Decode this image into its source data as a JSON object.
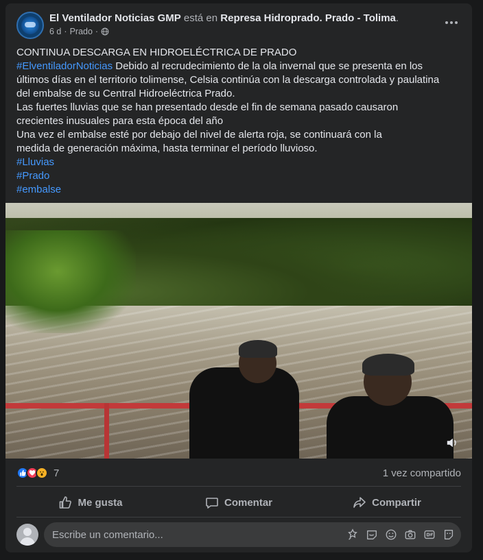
{
  "post": {
    "page_name": "El Ventilador Noticias GMP",
    "location_connector": "está en",
    "location": "Represa Hidroprado. Prado - Tolima",
    "location_suffix": ".",
    "time": "6 d",
    "place": "Prado",
    "separator": "·",
    "headline": "CONTINUA DESCARGA EN HIDROELÉCTRICA DE PRADO",
    "hashtag_main": "#ElventiladorNoticias",
    "body_lines": [
      " Debido al recrudecimiento de la ola invernal que se presenta en los",
      "últimos días en el territorio tolimense, Celsia continúa con la descarga controlada y paulatina",
      "del embalse de su Central Hidroeléctrica Prado.",
      "Las fuertes lluvias que se han presentado desde el fin de semana pasado causaron",
      "crecientes inusuales para esta época del año",
      "Una vez el embalse esté por debajo del nivel de alerta roja, se continuará con la",
      "medida de generación máxima, hasta terminar el período lluvioso."
    ],
    "tags": [
      "#Lluvias",
      "#Prado",
      "#embalse"
    ]
  },
  "stats": {
    "reaction_count": "7",
    "shares": "1 vez compartido"
  },
  "actions": {
    "like": "Me gusta",
    "comment": "Comentar",
    "share": "Compartir"
  },
  "comment": {
    "placeholder": "Escribe un comentario..."
  },
  "colors": {
    "background": "#18191a",
    "card": "#242526",
    "link": "#4599ff",
    "text": "#e4e6eb",
    "secondary_text": "#b0b3b8",
    "like_blue": "#2078f4",
    "love_red": "#f33e58",
    "wow_yellow": "#f7b125"
  },
  "icons": [
    "globe-icon",
    "more-options-icon",
    "like-icon",
    "comment-icon",
    "share-icon",
    "volume-icon",
    "avatar-icon",
    "sticker-icon",
    "gif-icon",
    "camera-icon",
    "emoji-icon",
    "avatar-sticker-icon"
  ]
}
